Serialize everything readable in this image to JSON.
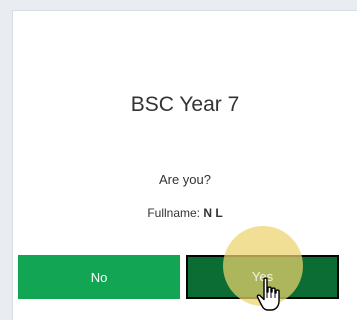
{
  "dialog": {
    "title": "BSC Year 7",
    "question": "Are you?",
    "fullname_label": "Fullname:",
    "fullname_value": "N L"
  },
  "buttons": {
    "no_label": "No",
    "yes_label": "Yes"
  },
  "colors": {
    "no_button": "#12a554",
    "yes_button": "#0b6d34",
    "click_highlight": "#ecd26e"
  },
  "icons": {
    "cursor": "hand-pointer-icon"
  }
}
